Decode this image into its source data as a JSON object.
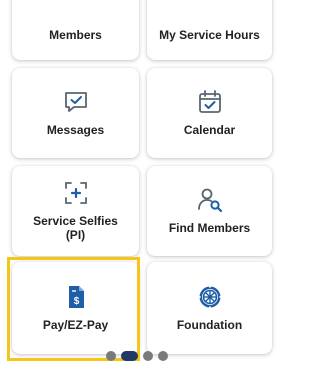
{
  "tiles": {
    "members": "Members",
    "service_hours": "My Service Hours",
    "messages": "Messages",
    "calendar": "Calendar",
    "service_selfies_line1": "Service Selfies",
    "service_selfies_line2": "(PI)",
    "find_members": "Find Members",
    "pay": "Pay/EZ-Pay",
    "foundation": "Foundation"
  },
  "icons": {
    "messages": "chat-bubble-check-icon",
    "calendar": "calendar-check-icon",
    "service_selfies": "camera-frame-plus-icon",
    "find_members": "person-search-icon",
    "pay": "document-dollar-icon",
    "foundation": "rotary-wheel-icon"
  },
  "pagination": {
    "count": 4,
    "active_index": 1
  },
  "colors": {
    "icon_blue": "#1f5fa8",
    "highlight": "#f5c518",
    "dot_active": "#1f3a66",
    "dot_inactive": "#7a7a7a"
  }
}
